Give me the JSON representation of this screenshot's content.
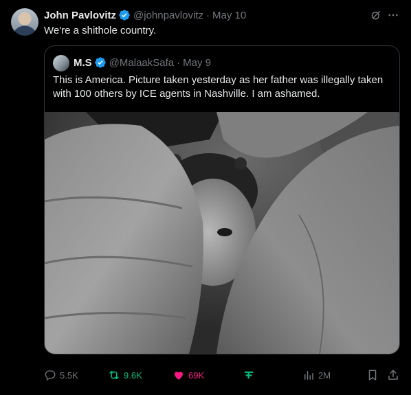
{
  "tweet": {
    "author_name": "John Pavlovitz",
    "author_handle": "@johnpavlovitz",
    "separator": "·",
    "date": "May 10",
    "text": "We're a shithole country."
  },
  "quoted": {
    "author_name": "M.S",
    "author_handle": "@MalaakSafa",
    "separator": "·",
    "date": "May 9",
    "text": "This is America. Picture taken yesterday as her father was illegally taken with 100 others by ICE agents in Nashville. I am ashamed."
  },
  "actions": {
    "replies": "5.5K",
    "reposts": "9.6K",
    "likes": "69K",
    "views": "2M"
  },
  "colors": {
    "background": "#000000",
    "text": "#e7e9ea",
    "muted": "#71767b",
    "verified": "#1d9bf0",
    "repost_active": "#00ba7c",
    "like_active": "#f91880"
  },
  "icons": [
    "verified-badge-icon",
    "grok-icon",
    "more-icon",
    "reply-icon",
    "repost-icon",
    "like-icon",
    "grok-action-icon",
    "views-icon",
    "bookmark-icon",
    "share-icon"
  ]
}
